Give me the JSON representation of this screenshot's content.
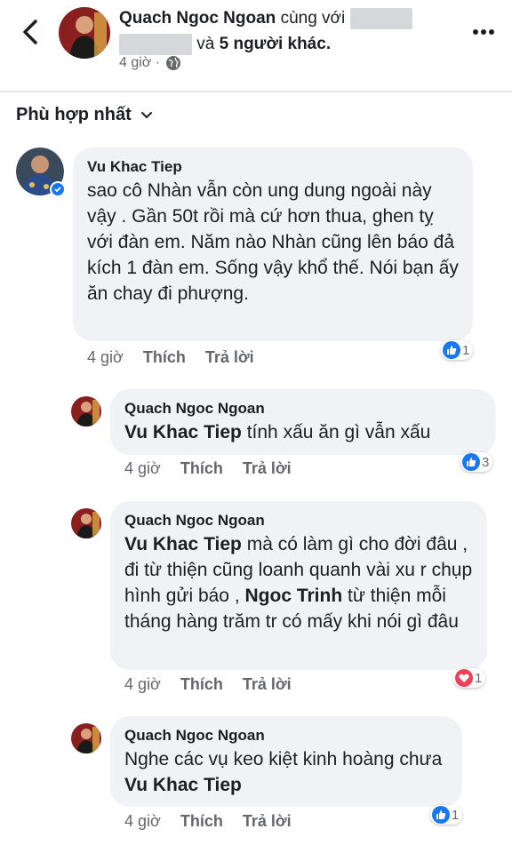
{
  "header": {
    "author": "Quach Ngoc Ngoan",
    "with_text": " cùng với ",
    "and_text": " và ",
    "others": "5 người khác.",
    "time": "4 giờ · "
  },
  "sort": {
    "label": "Phù hợp nhất"
  },
  "comments": [
    {
      "author": "Vu Khac Tiep",
      "text": "sao cô Nhàn vẫn còn ung dung ngoài này vậy . Gần 50t rồi mà cứ hơn thua, ghen tỵ với đàn em. Năm nào Nhàn cũng lên báo đả kích 1 đàn em. Sống vậy khổ thế. Nói bạn ấy ăn chay đi phượng.",
      "time": "4 giờ",
      "like": "Thích",
      "reply": "Trả lời",
      "reaction_count": "1"
    },
    {
      "author": "Quach Ngoc Ngoan",
      "mention": "Vu Khac Tiep",
      "text": " tính xấu ăn gì vẫn xấu",
      "time": "4 giờ",
      "like": "Thích",
      "reply": "Trả lời",
      "reaction_count": "3"
    },
    {
      "author": "Quach Ngoc Ngoan",
      "mention": "Vu Khac Tiep",
      "text_a": " mà có làm gì cho đời đâu , đi từ thiện cũng loanh quanh vài xu r chụp hình gửi báo , ",
      "mention2": "Ngoc Trinh",
      "text_b": " từ thiện mỗi tháng hàng trăm tr có mấy khi nói gì đâu",
      "time": "4 giờ",
      "like": "Thích",
      "reply": "Trả lời",
      "reaction_count": "1"
    },
    {
      "author": "Quach Ngoc Ngoan",
      "text": "Nghe các vụ keo kiệt kinh hoàng chưa ",
      "mention": "Vu Khac Tiep",
      "time": "4 giờ",
      "like": "Thích",
      "reply": "Trả lời",
      "reaction_count": "1"
    }
  ],
  "colors": {
    "like_blue": "#1877f2",
    "love_red": "#f33e58",
    "bubble": "#f0f2f5",
    "meta": "#65676b"
  },
  "icons": {
    "back": "chevron-left-icon",
    "more": "more-dots-icon",
    "globe": "globe-icon",
    "sort": "chevron-down-icon"
  }
}
